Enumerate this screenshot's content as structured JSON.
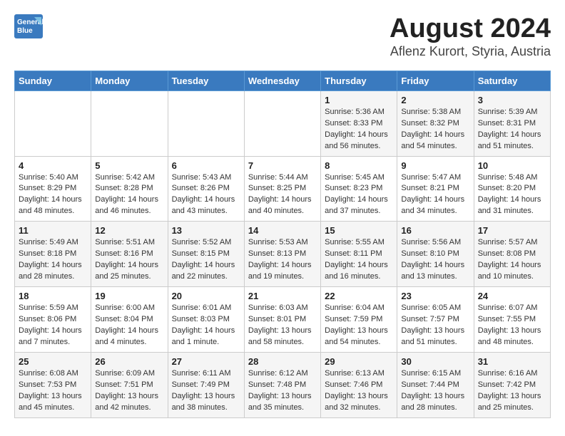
{
  "header": {
    "logo_general": "General",
    "logo_blue": "Blue",
    "title": "August 2024",
    "subtitle": "Aflenz Kurort, Styria, Austria"
  },
  "columns": [
    "Sunday",
    "Monday",
    "Tuesday",
    "Wednesday",
    "Thursday",
    "Friday",
    "Saturday"
  ],
  "weeks": [
    {
      "days": [
        {
          "num": "",
          "info": ""
        },
        {
          "num": "",
          "info": ""
        },
        {
          "num": "",
          "info": ""
        },
        {
          "num": "",
          "info": ""
        },
        {
          "num": "1",
          "info": "Sunrise: 5:36 AM\nSunset: 8:33 PM\nDaylight: 14 hours and 56 minutes."
        },
        {
          "num": "2",
          "info": "Sunrise: 5:38 AM\nSunset: 8:32 PM\nDaylight: 14 hours and 54 minutes."
        },
        {
          "num": "3",
          "info": "Sunrise: 5:39 AM\nSunset: 8:31 PM\nDaylight: 14 hours and 51 minutes."
        }
      ]
    },
    {
      "days": [
        {
          "num": "4",
          "info": "Sunrise: 5:40 AM\nSunset: 8:29 PM\nDaylight: 14 hours and 48 minutes."
        },
        {
          "num": "5",
          "info": "Sunrise: 5:42 AM\nSunset: 8:28 PM\nDaylight: 14 hours and 46 minutes."
        },
        {
          "num": "6",
          "info": "Sunrise: 5:43 AM\nSunset: 8:26 PM\nDaylight: 14 hours and 43 minutes."
        },
        {
          "num": "7",
          "info": "Sunrise: 5:44 AM\nSunset: 8:25 PM\nDaylight: 14 hours and 40 minutes."
        },
        {
          "num": "8",
          "info": "Sunrise: 5:45 AM\nSunset: 8:23 PM\nDaylight: 14 hours and 37 minutes."
        },
        {
          "num": "9",
          "info": "Sunrise: 5:47 AM\nSunset: 8:21 PM\nDaylight: 14 hours and 34 minutes."
        },
        {
          "num": "10",
          "info": "Sunrise: 5:48 AM\nSunset: 8:20 PM\nDaylight: 14 hours and 31 minutes."
        }
      ]
    },
    {
      "days": [
        {
          "num": "11",
          "info": "Sunrise: 5:49 AM\nSunset: 8:18 PM\nDaylight: 14 hours and 28 minutes."
        },
        {
          "num": "12",
          "info": "Sunrise: 5:51 AM\nSunset: 8:16 PM\nDaylight: 14 hours and 25 minutes."
        },
        {
          "num": "13",
          "info": "Sunrise: 5:52 AM\nSunset: 8:15 PM\nDaylight: 14 hours and 22 minutes."
        },
        {
          "num": "14",
          "info": "Sunrise: 5:53 AM\nSunset: 8:13 PM\nDaylight: 14 hours and 19 minutes."
        },
        {
          "num": "15",
          "info": "Sunrise: 5:55 AM\nSunset: 8:11 PM\nDaylight: 14 hours and 16 minutes."
        },
        {
          "num": "16",
          "info": "Sunrise: 5:56 AM\nSunset: 8:10 PM\nDaylight: 14 hours and 13 minutes."
        },
        {
          "num": "17",
          "info": "Sunrise: 5:57 AM\nSunset: 8:08 PM\nDaylight: 14 hours and 10 minutes."
        }
      ]
    },
    {
      "days": [
        {
          "num": "18",
          "info": "Sunrise: 5:59 AM\nSunset: 8:06 PM\nDaylight: 14 hours and 7 minutes."
        },
        {
          "num": "19",
          "info": "Sunrise: 6:00 AM\nSunset: 8:04 PM\nDaylight: 14 hours and 4 minutes."
        },
        {
          "num": "20",
          "info": "Sunrise: 6:01 AM\nSunset: 8:03 PM\nDaylight: 14 hours and 1 minute."
        },
        {
          "num": "21",
          "info": "Sunrise: 6:03 AM\nSunset: 8:01 PM\nDaylight: 13 hours and 58 minutes."
        },
        {
          "num": "22",
          "info": "Sunrise: 6:04 AM\nSunset: 7:59 PM\nDaylight: 13 hours and 54 minutes."
        },
        {
          "num": "23",
          "info": "Sunrise: 6:05 AM\nSunset: 7:57 PM\nDaylight: 13 hours and 51 minutes."
        },
        {
          "num": "24",
          "info": "Sunrise: 6:07 AM\nSunset: 7:55 PM\nDaylight: 13 hours and 48 minutes."
        }
      ]
    },
    {
      "days": [
        {
          "num": "25",
          "info": "Sunrise: 6:08 AM\nSunset: 7:53 PM\nDaylight: 13 hours and 45 minutes."
        },
        {
          "num": "26",
          "info": "Sunrise: 6:09 AM\nSunset: 7:51 PM\nDaylight: 13 hours and 42 minutes."
        },
        {
          "num": "27",
          "info": "Sunrise: 6:11 AM\nSunset: 7:49 PM\nDaylight: 13 hours and 38 minutes."
        },
        {
          "num": "28",
          "info": "Sunrise: 6:12 AM\nSunset: 7:48 PM\nDaylight: 13 hours and 35 minutes."
        },
        {
          "num": "29",
          "info": "Sunrise: 6:13 AM\nSunset: 7:46 PM\nDaylight: 13 hours and 32 minutes."
        },
        {
          "num": "30",
          "info": "Sunrise: 6:15 AM\nSunset: 7:44 PM\nDaylight: 13 hours and 28 minutes."
        },
        {
          "num": "31",
          "info": "Sunrise: 6:16 AM\nSunset: 7:42 PM\nDaylight: 13 hours and 25 minutes."
        }
      ]
    }
  ]
}
